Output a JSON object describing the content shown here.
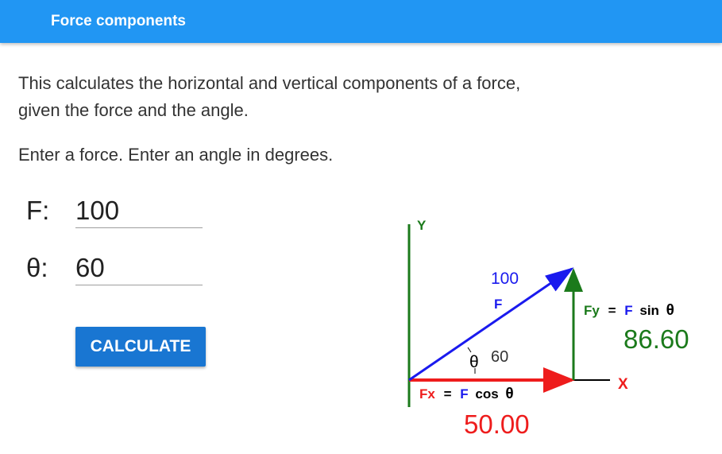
{
  "appbar": {
    "title": "Force components"
  },
  "intro": {
    "line1": "This calculates the horizontal and vertical components of a force,",
    "line2": "given the force and the angle."
  },
  "instructions": "Enter a force.  Enter an angle in degrees.",
  "form": {
    "force_label": "F:",
    "force_value": "100",
    "angle_label": "θ:",
    "angle_value": "60",
    "calculate_label": "CALCULATE"
  },
  "diagram": {
    "y_axis_label": "Y",
    "x_axis_label": "X",
    "force_value": "100",
    "force_label": "F",
    "theta_symbol": "θ",
    "angle_value": "60",
    "fx_formula": {
      "lhs": "Fx",
      "eq": "=",
      "f": "F",
      "fn": "cos",
      "theta": "θ"
    },
    "fy_formula": {
      "lhs": "Fy",
      "eq": "=",
      "f": "F",
      "fn": "sin",
      "theta": "θ"
    },
    "fx_result": "50.00",
    "fy_result": "86.60",
    "colors": {
      "axis_y": "#1b7a1b",
      "force_vector": "#1a1aee",
      "fx_component": "#ee1c1c",
      "fy_component": "#1b7a1b",
      "axis_x": "#000000",
      "result_fx": "#ee1c1c",
      "result_fy": "#1b7a1b"
    }
  }
}
